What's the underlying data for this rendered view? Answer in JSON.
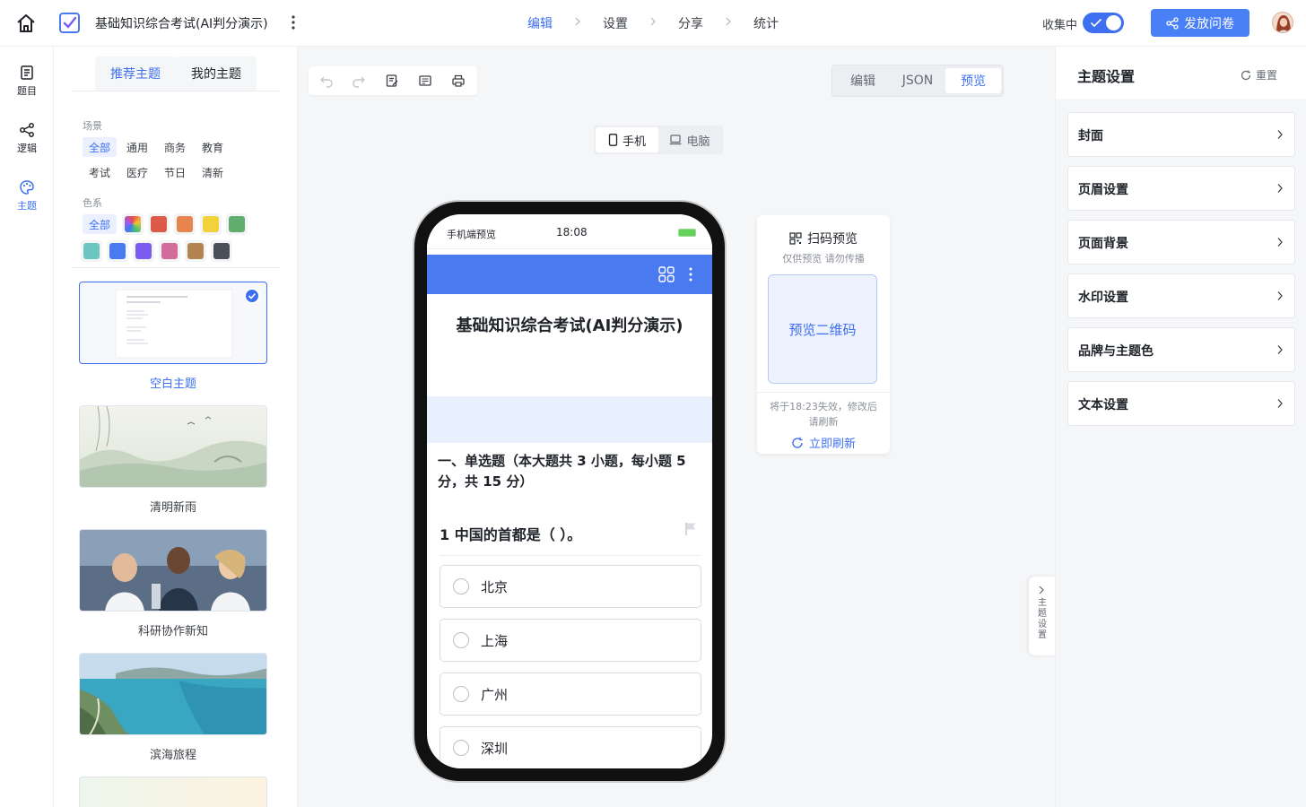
{
  "header": {
    "doc_title": "基础知识综合考试(AI判分演示)",
    "steps": [
      "编辑",
      "设置",
      "分享",
      "统计"
    ],
    "active_step": "编辑",
    "collect_label": "收集中",
    "collect_on": true,
    "publish_label": "发放问卷",
    "accent_color": "#3e6ff0"
  },
  "rail": {
    "items": [
      {
        "label": "题目",
        "icon": "document-icon"
      },
      {
        "label": "逻辑",
        "icon": "logic-icon"
      },
      {
        "label": "主题",
        "icon": "palette-icon",
        "active": true
      }
    ]
  },
  "theme_panel": {
    "tabs": [
      "推荐主题",
      "我的主题"
    ],
    "active_tab": "推荐主题",
    "scene_label": "场景",
    "scenes": [
      "全部",
      "通用",
      "商务",
      "教育",
      "考试",
      "医疗",
      "节日",
      "清新"
    ],
    "selected_scene": "全部",
    "color_label": "色系",
    "color_all": "全部",
    "swatches": [
      "rainbow",
      "#dd5a49",
      "#e8844e",
      "#f2d23b",
      "#5fae6e",
      "#6cc6c1",
      "#4a7af0",
      "#7b5cf0",
      "#d46c9b",
      "#b38450",
      "#4a4f5a"
    ],
    "themes": [
      {
        "name": "空白主题",
        "selected": true
      },
      {
        "name": "清明新雨"
      },
      {
        "name": "科研协作新知"
      },
      {
        "name": "滨海旅程"
      }
    ]
  },
  "canvas": {
    "view_modes": [
      "编辑",
      "JSON",
      "预览"
    ],
    "active_view": "预览",
    "devices": [
      "手机",
      "电脑"
    ],
    "active_device": "手机"
  },
  "phone": {
    "status_title": "手机端预览",
    "time": "18:08",
    "survey_title": "基础知识综合考试(AI判分演示)",
    "section_heading": "一、单选题（本大题共 3 小题，每小题 5 分，共 15 分）",
    "question": "1 中国的首都是（ ）。",
    "options": [
      "北京",
      "上海",
      "广州",
      "深圳"
    ]
  },
  "qr": {
    "title": "扫码预览",
    "subtitle": "仅供预览 请勿传播",
    "placeholder": "预览二维码",
    "expire_text": "将于18:23失效，修改后请刷新",
    "refresh_label": "立即刷新"
  },
  "right_panel": {
    "title": "主题设置",
    "reset_label": "重置",
    "handle_label": "主题设置",
    "items": [
      "封面",
      "页眉设置",
      "页面背景",
      "水印设置",
      "品牌与主题色",
      "文本设置"
    ]
  }
}
